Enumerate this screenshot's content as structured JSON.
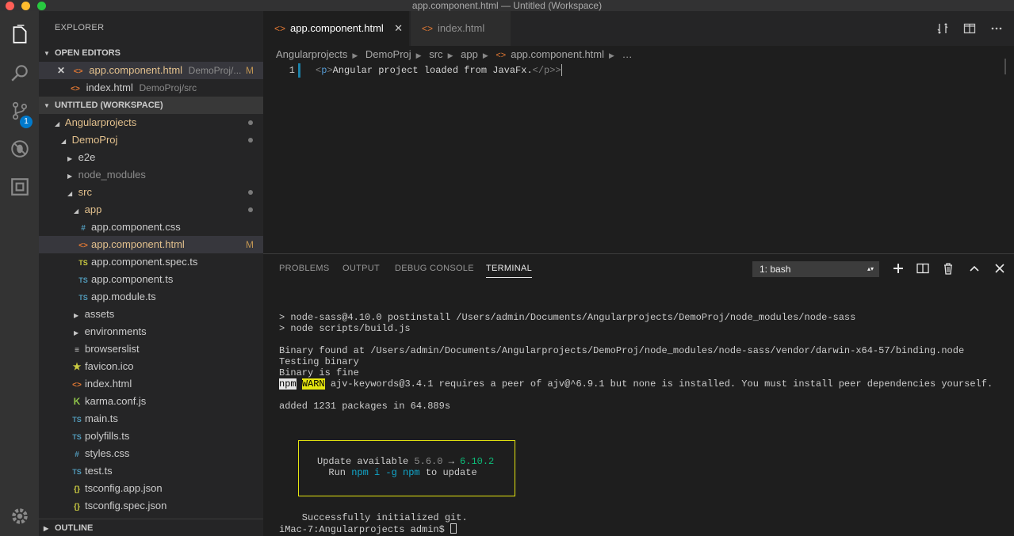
{
  "window": {
    "title": "app.component.html — Untitled (Workspace)"
  },
  "activity_bar": {
    "scm_badge": "1"
  },
  "sidebar": {
    "title": "EXPLORER",
    "open_editors": {
      "header": "OPEN EDITORS",
      "items": [
        {
          "name": "app.component.html",
          "path": "DemoProj/...",
          "status": "M"
        },
        {
          "name": "index.html",
          "path": "DemoProj/src"
        }
      ]
    },
    "workspace": {
      "header": "UNTITLED (WORKSPACE)",
      "tree": [
        "Angularprojects",
        "DemoProj",
        "e2e",
        "node_modules",
        "src",
        "app",
        "app.component.css",
        "app.component.html",
        "app.component.spec.ts",
        "app.component.ts",
        "app.module.ts",
        "assets",
        "environments",
        "browserslist",
        "favicon.ico",
        "index.html",
        "karma.conf.js",
        "main.ts",
        "polyfills.ts",
        "styles.css",
        "test.ts",
        "tsconfig.app.json",
        "tsconfig.spec.json"
      ],
      "selected_status": "M"
    },
    "outline_header": "OUTLINE"
  },
  "editor": {
    "tabs": [
      {
        "label": "app.component.html",
        "active": true
      },
      {
        "label": "index.html",
        "active": false
      }
    ],
    "breadcrumb": [
      "Angularprojects",
      "DemoProj",
      "src",
      "app",
      "app.component.html",
      "…"
    ],
    "line_number": "1",
    "code": {
      "open_tag_lt": "<",
      "tag_name": "p",
      "open_tag_gt": ">",
      "text": "Angular project loaded from JavaFx.",
      "close_tag": "</p>",
      "trailing": ">"
    }
  },
  "panel": {
    "tabs": [
      "PROBLEMS",
      "OUTPUT",
      "DEBUG CONSOLE",
      "TERMINAL"
    ],
    "active_tab": "TERMINAL",
    "terminal_select": "1: bash",
    "terminal": {
      "lines_1": "> node-sass@4.10.0 postinstall /Users/admin/Documents/Angularprojects/DemoProj/node_modules/node-sass\n> node scripts/build.js\n\nBinary found at /Users/admin/Documents/Angularprojects/DemoProj/node_modules/node-sass/vendor/darwin-x64-57/binding.node\nTesting binary\nBinary is fine",
      "npm": "npm",
      "warn": "WARN",
      "warn_msg": " ajv-keywords@3.4.1 requires a peer of ajv@^6.9.1 but none is installed. You must install peer dependencies yourself.",
      "added": "added 1231 packages in 64.889s",
      "update_prefix": "Update available ",
      "update_old": "5.6.0",
      "update_arrow": " → ",
      "update_new": "6.10.2",
      "run_prefix": "  Run ",
      "run_cmd": "npm i -g npm",
      "run_suffix": " to update",
      "success": "    Successfully initialized git.",
      "prompt": "iMac-7:Angularprojects admin$ "
    }
  },
  "colors": {
    "accent": "#007acc",
    "modified": "#e2c08d",
    "html_icon": "#e37933",
    "ts_icon": "#519aba",
    "css_icon": "#519aba",
    "json_icon": "#cbcb41",
    "warn_bg": "#e5e510"
  }
}
